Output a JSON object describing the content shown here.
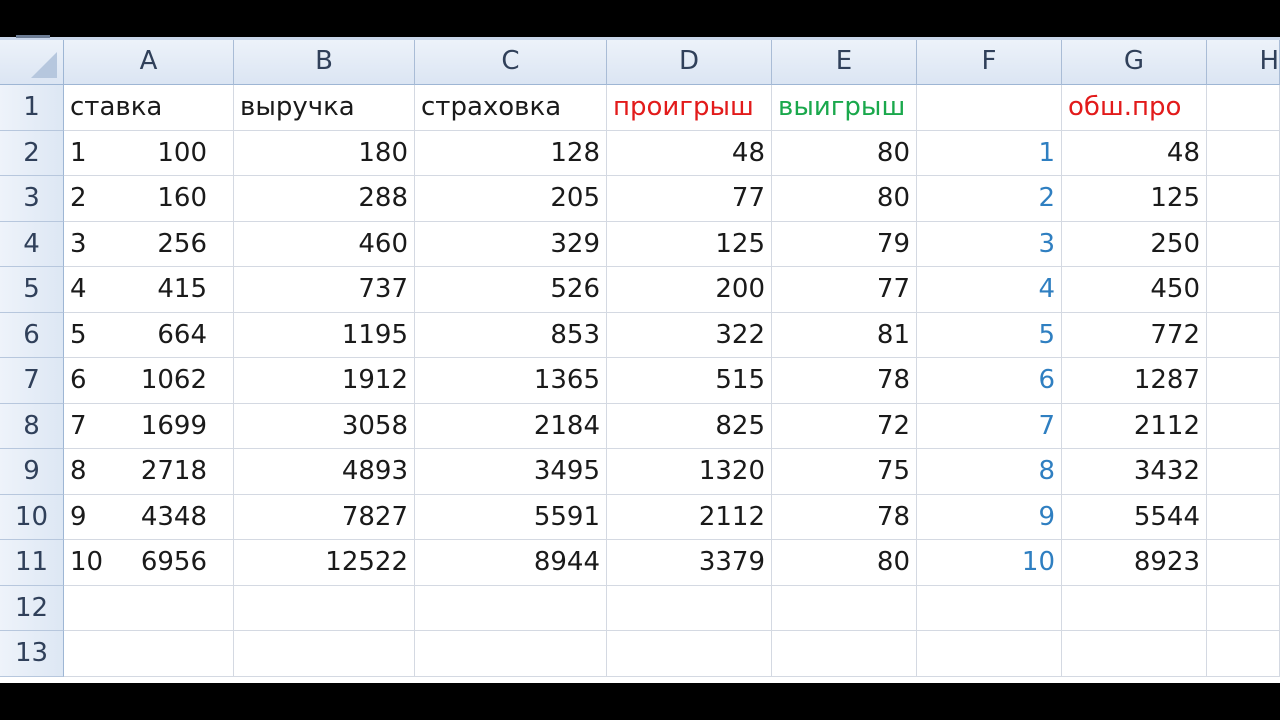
{
  "column_headers": [
    "A",
    "B",
    "C",
    "D",
    "E",
    "F",
    "G",
    "H"
  ],
  "row_headers": [
    "1",
    "2",
    "3",
    "4",
    "5",
    "6",
    "7",
    "8",
    "9",
    "10",
    "11",
    "12",
    "13"
  ],
  "header_row": {
    "A": "ставка",
    "B": "выручка",
    "C": "страховка",
    "D": "проигрыш",
    "E": "выигрыш",
    "F": "",
    "G": "обш.про"
  },
  "colors": {
    "lose": "#e21b1b",
    "win": "#1aa84c",
    "index_blue": "#2f7fc1"
  },
  "rows": [
    {
      "a1": "1",
      "a2": "100",
      "b": "180",
      "c": "128",
      "d": "48",
      "e": "80",
      "f": "1",
      "g": "48"
    },
    {
      "a1": "2",
      "a2": "160",
      "b": "288",
      "c": "205",
      "d": "77",
      "e": "80",
      "f": "2",
      "g": "125"
    },
    {
      "a1": "3",
      "a2": "256",
      "b": "460",
      "c": "329",
      "d": "125",
      "e": "79",
      "f": "3",
      "g": "250"
    },
    {
      "a1": "4",
      "a2": "415",
      "b": "737",
      "c": "526",
      "d": "200",
      "e": "77",
      "f": "4",
      "g": "450"
    },
    {
      "a1": "5",
      "a2": "664",
      "b": "1195",
      "c": "853",
      "d": "322",
      "e": "81",
      "f": "5",
      "g": "772"
    },
    {
      "a1": "6",
      "a2": "1062",
      "b": "1912",
      "c": "1365",
      "d": "515",
      "e": "78",
      "f": "6",
      "g": "1287"
    },
    {
      "a1": "7",
      "a2": "1699",
      "b": "3058",
      "c": "2184",
      "d": "825",
      "e": "72",
      "f": "7",
      "g": "2112"
    },
    {
      "a1": "8",
      "a2": "2718",
      "b": "4893",
      "c": "3495",
      "d": "1320",
      "e": "75",
      "f": "8",
      "g": "3432"
    },
    {
      "a1": "9",
      "a2": "4348",
      "b": "7827",
      "c": "5591",
      "d": "2112",
      "e": "78",
      "f": "9",
      "g": "5544"
    },
    {
      "a1": "10",
      "a2": "6956",
      "b": "12522",
      "c": "8944",
      "d": "3379",
      "e": "80",
      "f": "10",
      "g": "8923"
    }
  ]
}
